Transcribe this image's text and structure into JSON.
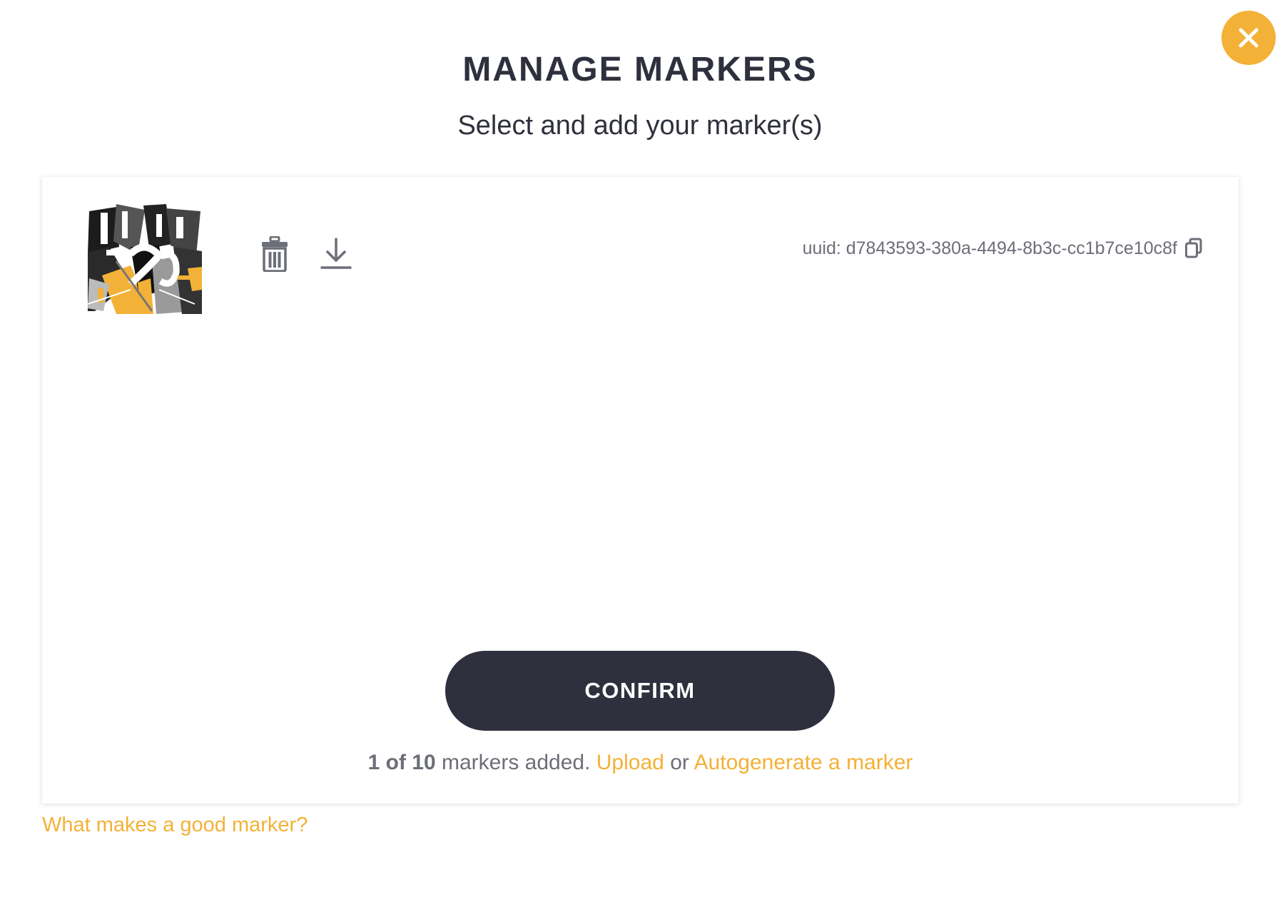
{
  "header": {
    "title": "MANAGE MARKERS",
    "subtitle": "Select and add your marker(s)"
  },
  "close_button": {
    "icon": "close-icon",
    "color": "#f3b137"
  },
  "markers": [
    {
      "thumbnail_icon": "marker-image",
      "actions": {
        "delete_icon": "trash-icon",
        "download_icon": "download-icon"
      },
      "uuid_text": "uuid: d7843593-380a-4494-8b3c-cc1b7ce10c8f",
      "copy_icon": "copy-icon"
    }
  ],
  "confirm": {
    "label": "CONFIRM"
  },
  "status": {
    "count": "1 of 10",
    "text": "markers added.",
    "upload_link": "Upload",
    "or": "or",
    "autogenerate_link": "Autogenerate a marker"
  },
  "help_link": "What makes a good marker?",
  "colors": {
    "accent": "#f3b137",
    "dark": "#2e303d",
    "muted": "#6c6e78"
  }
}
